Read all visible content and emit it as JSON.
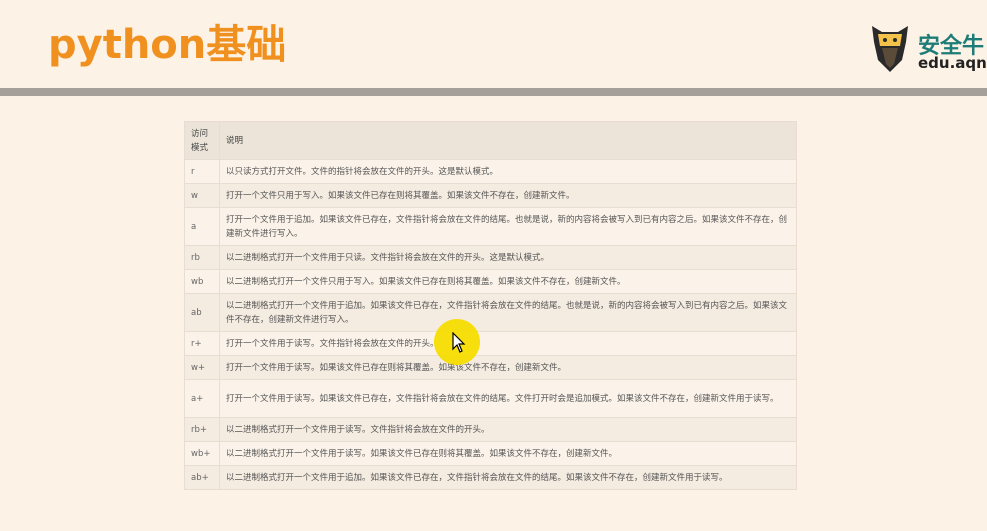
{
  "slide": {
    "title": "python基础",
    "logo": {
      "cn_text": "安全牛",
      "en_text": "edu.aqniu"
    }
  },
  "table": {
    "headers": [
      "访问\n模式",
      "说明"
    ],
    "rows": [
      {
        "mode": "r",
        "desc": "以只读方式打开文件。文件的指针将会放在文件的开头。这是默认模式。"
      },
      {
        "mode": "w",
        "desc": "打开一个文件只用于写入。如果该文件已存在则将其覆盖。如果该文件不存在，创建新文件。"
      },
      {
        "mode": "a",
        "desc": "打开一个文件用于追加。如果该文件已存在，文件指针将会放在文件的结尾。也就是说，新的内容将会被写入到已有内容之后。如果该文件不存在，创建新文件进行写入。"
      },
      {
        "mode": "rb",
        "desc": "以二进制格式打开一个文件用于只读。文件指针将会放在文件的开头。这是默认模式。"
      },
      {
        "mode": "wb",
        "desc": "以二进制格式打开一个文件只用于写入。如果该文件已存在则将其覆盖。如果该文件不存在，创建新文件。"
      },
      {
        "mode": "ab",
        "desc": "以二进制格式打开一个文件用于追加。如果该文件已存在，文件指针将会放在文件的结尾。也就是说，新的内容将会被写入到已有内容之后。如果该文件不存在，创建新文件进行写入。"
      },
      {
        "mode": "r+",
        "desc": "打开一个文件用于读写。文件指针将会放在文件的开头。"
      },
      {
        "mode": "w+",
        "desc": "打开一个文件用于读写。如果该文件已存在则将其覆盖。如果该文件不存在，创建新文件。"
      },
      {
        "mode": "a+",
        "desc": "打开一个文件用于读写。如果该文件已存在，文件指针将会放在文件的结尾。文件打开时会是追加模式。如果该文件不存在，创建新文件用于读写。"
      },
      {
        "mode": "rb+",
        "desc": "以二进制格式打开一个文件用于读写。文件指针将会放在文件的开头。"
      },
      {
        "mode": "wb+",
        "desc": "以二进制格式打开一个文件用于读写。如果该文件已存在则将其覆盖。如果该文件不存在，创建新文件。"
      },
      {
        "mode": "ab+",
        "desc": "以二进制格式打开一个文件用于追加。如果该文件已存在，文件指针将会放在文件的结尾。如果该文件不存在，创建新文件用于读写。"
      }
    ]
  },
  "colors": {
    "background": "#fdf2e6",
    "title": "#f0901e",
    "divider": "#a5a19a",
    "header_row": "#ece4d9",
    "cursor_highlight": "#f6dd00"
  },
  "icons": {
    "logo": "bull-shield-icon",
    "cursor": "mouse-pointer-icon"
  }
}
